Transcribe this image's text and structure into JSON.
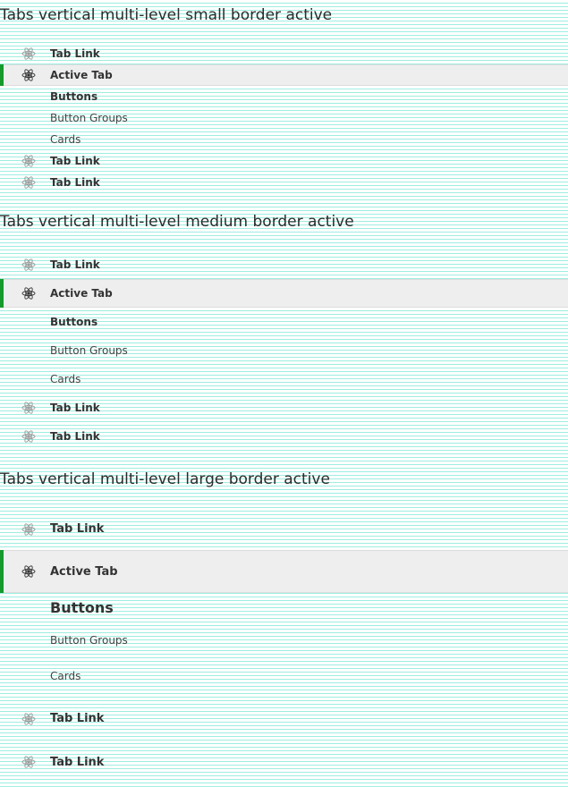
{
  "sections": [
    {
      "title": "Tabs vertical multi-level small border active",
      "items": [
        {
          "label": "Tab Link",
          "icon": "atom-icon"
        },
        {
          "label": "Active Tab",
          "icon": "atom-icon",
          "active": true
        },
        {
          "label": "Buttons"
        },
        {
          "label": "Button Groups"
        },
        {
          "label": "Cards"
        },
        {
          "label": "Tab Link",
          "icon": "atom-icon"
        },
        {
          "label": "Tab Link",
          "icon": "atom-icon"
        }
      ]
    },
    {
      "title": "Tabs vertical multi-level medium border active",
      "items": [
        {
          "label": "Tab Link",
          "icon": "atom-icon"
        },
        {
          "label": "Active Tab",
          "icon": "atom-icon",
          "active": true
        },
        {
          "label": "Buttons"
        },
        {
          "label": "Button Groups"
        },
        {
          "label": "Cards"
        },
        {
          "label": "Tab Link",
          "icon": "atom-icon"
        },
        {
          "label": "Tab Link",
          "icon": "atom-icon"
        }
      ]
    },
    {
      "title": "Tabs vertical multi-level large border active",
      "items": [
        {
          "label": "Tab Link",
          "icon": "atom-icon"
        },
        {
          "label": "Active Tab",
          "icon": "atom-icon",
          "active": true
        },
        {
          "label": "Buttons"
        },
        {
          "label": "Button Groups"
        },
        {
          "label": "Cards"
        },
        {
          "label": "Tab Link",
          "icon": "atom-icon"
        },
        {
          "label": "Tab Link",
          "icon": "atom-icon"
        }
      ]
    }
  ],
  "colors": {
    "active_border": "#159a2b",
    "active_bg": "#eeeeee",
    "background_lines": "#9eeee0"
  }
}
